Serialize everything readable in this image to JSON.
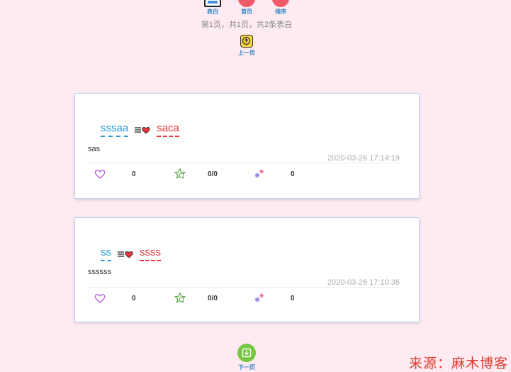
{
  "nav": {
    "biaobai_label": "表白",
    "home_label": "首页",
    "sort_label": "排序"
  },
  "pagination": {
    "info": "第1页，共1页，共2条表白",
    "prev_label": "上一页",
    "next_label": "下一页"
  },
  "posts": [
    {
      "from": "sssaa",
      "to": "saca",
      "content": "sas",
      "time": "2020-03-26 17:14:19",
      "likes": "0",
      "comments": "0/0",
      "gifts": "0"
    },
    {
      "from": "ss",
      "to": "ssss",
      "content": "ssssss",
      "time": "2020-03-26 17:10:36",
      "likes": "0",
      "comments": "0/0",
      "gifts": "0"
    }
  ],
  "watermark": "来源：麻木博客",
  "colors": {
    "background": "#fdebf1",
    "from_name": "#2a9bd8",
    "to_name": "#e8363b",
    "link": "#2f86c7"
  },
  "icons": {
    "like": "heart-outline-icon",
    "comment": "star-comment-icon",
    "gift": "flower-gift-icon",
    "arrow_heart": "arrow-heart-icon"
  }
}
